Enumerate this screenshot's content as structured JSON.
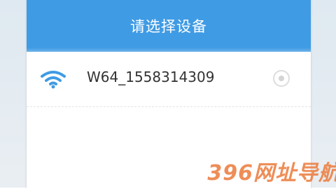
{
  "dialog": {
    "title": "请选择设备"
  },
  "devices": [
    {
      "name": "W64_1558314309",
      "selected": false,
      "icon": "wifi-icon"
    }
  ],
  "colors": {
    "header": "#3f9be4",
    "wifi_icon": "#3f9be4",
    "watermark": "#ec7a3a"
  },
  "watermark": "396网址导航"
}
